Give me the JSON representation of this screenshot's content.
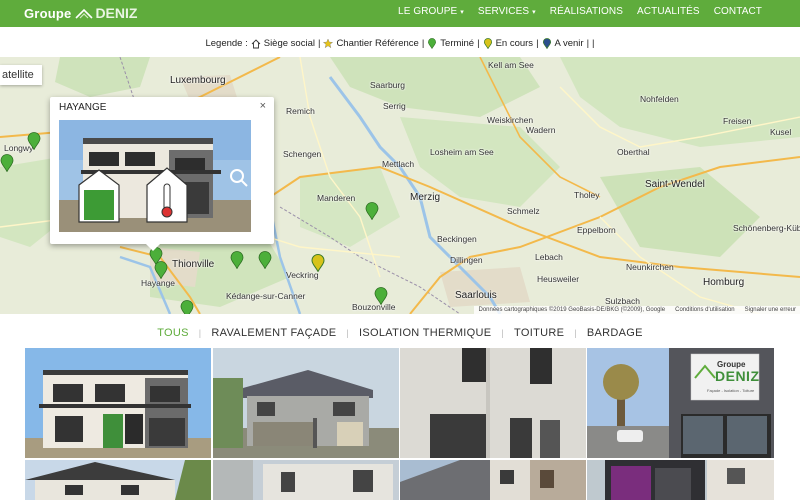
{
  "brand": {
    "name_part1": "Groupe",
    "name_part2": "DENIZ"
  },
  "nav": {
    "items": [
      {
        "label": "LE GROUPE",
        "has_dropdown": true
      },
      {
        "label": "SERVICES",
        "has_dropdown": true
      },
      {
        "label": "RÉALISATIONS",
        "has_dropdown": false
      },
      {
        "label": "ACTUALITÉS",
        "has_dropdown": false
      },
      {
        "label": "CONTACT",
        "has_dropdown": false
      }
    ],
    "caret": "▾"
  },
  "legend": {
    "prefix": "Legende :",
    "items": [
      {
        "label": "Siège social",
        "icon": "house-icon"
      },
      {
        "label": "Chantier Référence",
        "icon": "star-icon"
      },
      {
        "label": "Terminé",
        "icon": "pin-green-icon"
      },
      {
        "label": "En cours",
        "icon": "pin-yellow-icon"
      },
      {
        "label": "A venir",
        "icon": "pin-blue-icon"
      }
    ],
    "separator": "|"
  },
  "map": {
    "satellite_label": "atellite",
    "labels": [
      "Luxembourg",
      "Saarburg",
      "Serrig",
      "Kell am See",
      "Weiskirchen",
      "Wadern",
      "Nohfelden",
      "Mettlach",
      "Losheim am See",
      "Merzig",
      "Schmelz",
      "Beckingen",
      "Dillingen",
      "Lebach",
      "Saarlouis",
      "Heusweiler",
      "Thionville",
      "Hayange",
      "Schengen",
      "Manderen",
      "Veckring",
      "Kédange-sur-Canner",
      "Bouzonville",
      "Neunkirchen",
      "Homburg",
      "Saint-Wendel",
      "Oberthal",
      "Freisen",
      "Kusel",
      "Longwy",
      "Remich",
      "Tholey",
      "Eppelborn",
      "Sulzbach",
      "Schönenberg-Kübelberg"
    ],
    "attribution": "Données cartographiques ©2019 GeoBasis-DE/BKG (©2009), Google",
    "terms": "Conditions d'utilisation",
    "report": "Signaler une erreur"
  },
  "popup": {
    "title": "HAYANGE",
    "close": "×"
  },
  "filters": {
    "items": [
      "TOUS",
      "RAVALEMENT FAÇADE",
      "ISOLATION THERMIQUE",
      "TOITURE",
      "BARDAGE"
    ],
    "active": "TOUS",
    "separator": "|"
  },
  "gallery_sign": {
    "brand_part1": "Groupe",
    "brand_part2": "DENIZ",
    "tagline": "Façade - Isolation - Toiture"
  },
  "colors": {
    "brand_green": "#5fac3c",
    "pin_green": "#4caf3a",
    "pin_yellow": "#d7c31a"
  }
}
